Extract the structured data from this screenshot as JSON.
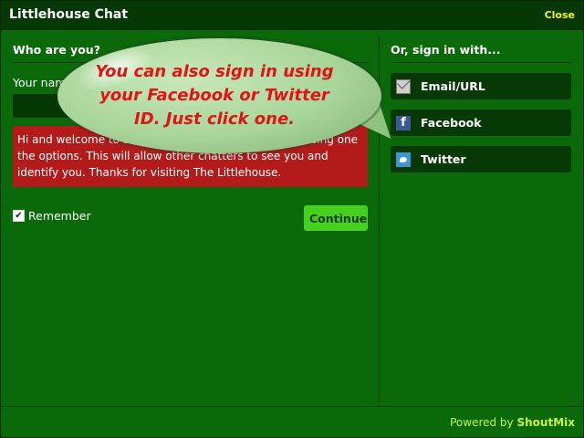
{
  "window": {
    "title": "Littlehouse Chat",
    "close_label": "Close"
  },
  "left": {
    "section_title": "Who are you?",
    "name_label": "Your name",
    "name_value": "",
    "welcome_text": "Hi and welcome to Littlehouse Chat. Please register using one the options. This will allow other chatters to see you and identify you. Thanks for visiting The Littlehouse.",
    "remember_label": "Remember",
    "remember_checked": "✔",
    "continue_label": "Continue"
  },
  "right": {
    "section_title": "Or, sign in with...",
    "buttons": [
      {
        "label": "Email/URL",
        "icon": "envelope-icon"
      },
      {
        "label": "Facebook",
        "icon": "facebook-icon",
        "glyph": "f"
      },
      {
        "label": "Twitter",
        "icon": "twitter-icon"
      }
    ]
  },
  "balloon": {
    "text": "You can also sign in using your Facebook or Twitter ID. Just click one."
  },
  "footer": {
    "powered_by": "Powered by",
    "brand": "ShoutMix"
  },
  "colors": {
    "background": "#0a6a0a",
    "titlebar": "#063806",
    "welcome_bg": "#b31a1a",
    "continue_bg": "#47d11f",
    "footer_text": "#c7f53b",
    "close_link": "#f2f21a",
    "balloon_text": "#e01414"
  }
}
